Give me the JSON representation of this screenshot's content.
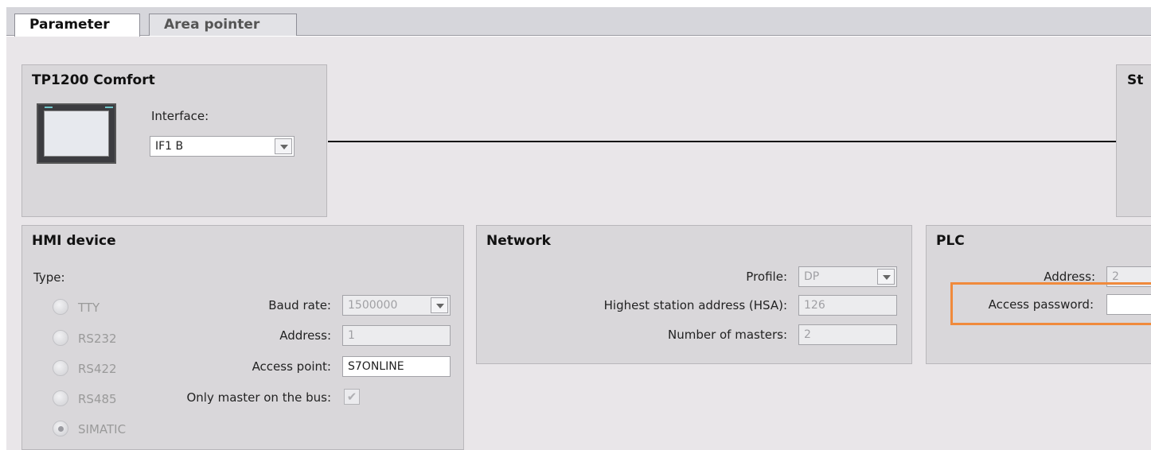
{
  "tabs": [
    {
      "label": "Parameter",
      "active": true
    },
    {
      "label": "Area pointer",
      "active": false
    }
  ],
  "device": {
    "title": "TP1200 Comfort",
    "interface_label": "Interface:",
    "interface_value": "IF1 B",
    "icon": "hmi-panel-icon"
  },
  "station_box": {
    "title_partial": "St"
  },
  "hmi_device": {
    "title": "HMI device",
    "type_label": "Type:",
    "types": [
      {
        "label": "TTY",
        "selected": false
      },
      {
        "label": "RS232",
        "selected": false
      },
      {
        "label": "RS422",
        "selected": false
      },
      {
        "label": "RS485",
        "selected": false
      },
      {
        "label": "SIMATIC",
        "selected": true
      }
    ],
    "baud_rate_label": "Baud rate:",
    "baud_rate_value": "1500000",
    "address_label": "Address:",
    "address_value": "1",
    "access_point_label": "Access point:",
    "access_point_value": "S7ONLINE",
    "only_master_label": "Only master on the bus:",
    "only_master_checked": true
  },
  "network": {
    "title": "Network",
    "profile_label": "Profile:",
    "profile_value": "DP",
    "hsa_label": "Highest station address (HSA):",
    "hsa_value": "126",
    "masters_label": "Number of masters:",
    "masters_value": "2"
  },
  "plc": {
    "title": "PLC",
    "address_label": "Address:",
    "address_value": "2",
    "access_password_label": "Access password:",
    "access_password_value": "",
    "highlight_color": "#f08a3c"
  }
}
